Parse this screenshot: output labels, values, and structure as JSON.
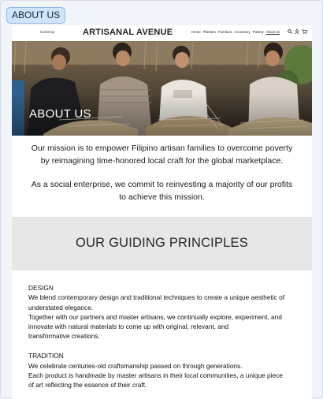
{
  "page_tag": "ABOUT US",
  "nav": {
    "currency": "Currency",
    "brand": "ARTISANAL AVENUE",
    "links": [
      "Home",
      "Planters",
      "Furniture",
      "Accessory",
      "Pottery",
      "About us"
    ],
    "active_link": "About us",
    "icons": [
      "search-icon",
      "user-icon",
      "cart-icon"
    ]
  },
  "hero": {
    "title": "ABOUT US",
    "alt": "Filipino artisans weaving"
  },
  "mission": {
    "paragraph_1_line_1": "Our mission is to empower Filipino artisan families to overcome poverty",
    "paragraph_1_line_2": "by reimagining time-honored local craft for the global marketplace.",
    "paragraph_2_line_1": "As a social enterprise, we commit to reinvesting a majority of our profits",
    "paragraph_2_line_2": "to achieve this mission."
  },
  "principles": {
    "heading": "OUR GUIDING PRINCIPLES",
    "items": [
      {
        "title": "DESIGN",
        "lines": [
          "We blend contemporary design and traditional techniques to create a unique aesthetic of",
          "understated elegance.",
          "Together with our partners and master artisans, we continually explore, experiment, and",
          "innovate with natural materials to come up with original, relevant, and",
          "transformative creations."
        ]
      },
      {
        "title": "TRADITION",
        "lines": [
          "We celebrate centuries-old craftsmanship passed on through generations.",
          "Each product is handmade by master artisans in their local communities, a unique piece",
          "of art reflecting the essence of their craft."
        ]
      }
    ]
  },
  "colors": {
    "tag_bg": "#cfe4fb",
    "tag_border": "#8fb7e6",
    "band_bg": "#e7e7e7",
    "text": "#1b1b1b"
  }
}
